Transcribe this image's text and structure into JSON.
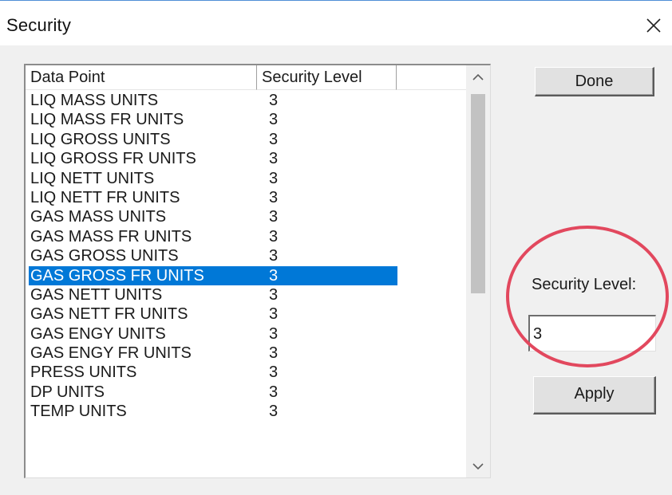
{
  "window": {
    "title": "Security",
    "close_icon": "close-icon"
  },
  "list": {
    "columns": [
      {
        "label": "Data Point"
      },
      {
        "label": "Security Level"
      }
    ],
    "rows": [
      {
        "data_point": "LIQ MASS UNITS",
        "security_level": "3"
      },
      {
        "data_point": "LIQ MASS FR UNITS",
        "security_level": "3"
      },
      {
        "data_point": "LIQ GROSS UNITS",
        "security_level": "3"
      },
      {
        "data_point": "LIQ GROSS FR UNITS",
        "security_level": "3"
      },
      {
        "data_point": "LIQ NETT UNITS",
        "security_level": "3"
      },
      {
        "data_point": "LIQ NETT FR UNITS",
        "security_level": "3"
      },
      {
        "data_point": "GAS MASS UNITS",
        "security_level": "3"
      },
      {
        "data_point": "GAS MASS FR UNITS",
        "security_level": "3"
      },
      {
        "data_point": "GAS GROSS UNITS",
        "security_level": "3"
      },
      {
        "data_point": "GAS GROSS FR UNITS",
        "security_level": "3",
        "selected": true
      },
      {
        "data_point": "GAS NETT UNITS",
        "security_level": "3"
      },
      {
        "data_point": "GAS NETT FR UNITS",
        "security_level": "3"
      },
      {
        "data_point": "GAS ENGY UNITS",
        "security_level": "3"
      },
      {
        "data_point": "GAS ENGY FR UNITS",
        "security_level": "3"
      },
      {
        "data_point": "PRESS UNITS",
        "security_level": "3"
      },
      {
        "data_point": "DP UNITS",
        "security_level": "3"
      },
      {
        "data_point": "TEMP UNITS",
        "security_level": "3"
      }
    ],
    "selected_index": 9
  },
  "buttons": {
    "done_label": "Done",
    "apply_label": "Apply"
  },
  "security_level": {
    "label": "Security Level:",
    "value": "3"
  },
  "colors": {
    "selection": "#0078d7",
    "highlight_circle": "#e2485e",
    "dialog_background": "#f0f0f0"
  }
}
